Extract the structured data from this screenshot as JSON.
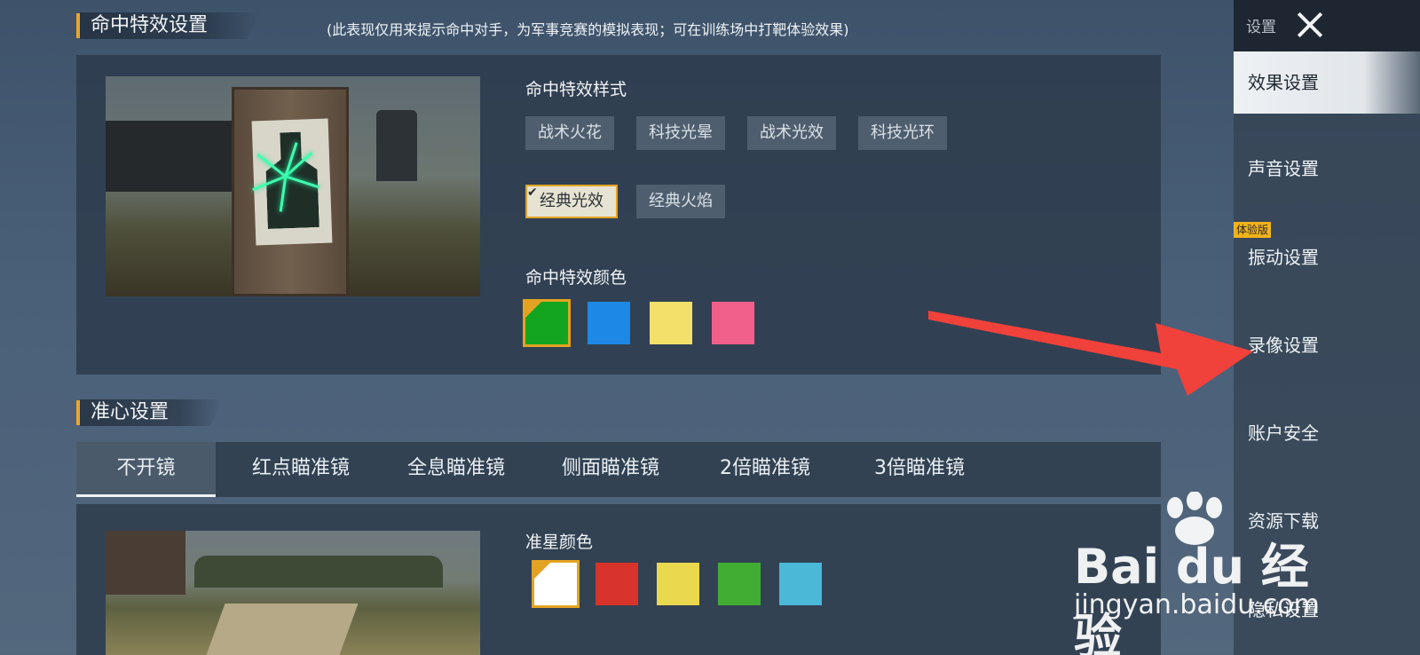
{
  "hit_effect": {
    "title": "命中特效设置",
    "note": "(此表现仅用来提示命中对手，为军事竞赛的模拟表现；可在训练场中打靶体验效果)",
    "style_label": "命中特效样式",
    "styles": [
      {
        "label": "战术火花",
        "selected": false
      },
      {
        "label": "科技光晕",
        "selected": false
      },
      {
        "label": "战术光效",
        "selected": false
      },
      {
        "label": "科技光环",
        "selected": false
      },
      {
        "label": "经典光效",
        "selected": true
      },
      {
        "label": "经典火焰",
        "selected": false
      }
    ],
    "color_label": "命中特效颜色",
    "colors": [
      {
        "hex": "#13a51f",
        "selected": true
      },
      {
        "hex": "#1d88e5",
        "selected": false
      },
      {
        "hex": "#f2e06a",
        "selected": false
      },
      {
        "hex": "#f0608a",
        "selected": false
      }
    ]
  },
  "crosshair": {
    "title": "准心设置",
    "tabs": [
      {
        "label": "不开镜",
        "active": true
      },
      {
        "label": "红点瞄准镜",
        "active": false
      },
      {
        "label": "全息瞄准镜",
        "active": false
      },
      {
        "label": "侧面瞄准镜",
        "active": false
      },
      {
        "label": "2倍瞄准镜",
        "active": false
      },
      {
        "label": "3倍瞄准镜",
        "active": false
      }
    ],
    "color_label": "准星颜色",
    "colors": [
      {
        "hex": "#ffffff",
        "selected": true
      },
      {
        "hex": "#d9342b",
        "selected": false
      },
      {
        "hex": "#ead84f",
        "selected": false
      },
      {
        "hex": "#41ad32",
        "selected": false
      },
      {
        "hex": "#4ab8d6",
        "selected": false
      }
    ]
  },
  "sidebar": {
    "header": "设置",
    "close_icon": "close-icon",
    "trial_badge": "体验版",
    "items": [
      {
        "label": "效果设置",
        "active": true
      },
      {
        "label": "声音设置",
        "active": false
      },
      {
        "label": "振动设置",
        "active": false
      },
      {
        "label": "录像设置",
        "active": false
      },
      {
        "label": "账户安全",
        "active": false
      },
      {
        "label": "资源下载",
        "active": false
      },
      {
        "label": "隐私设置",
        "active": false
      }
    ]
  },
  "watermark": {
    "brand": "Bai du 经验",
    "url": "jingyan.baidu.com"
  },
  "colors": {
    "accent": "#e3a322",
    "arrow": "#f0413a"
  }
}
